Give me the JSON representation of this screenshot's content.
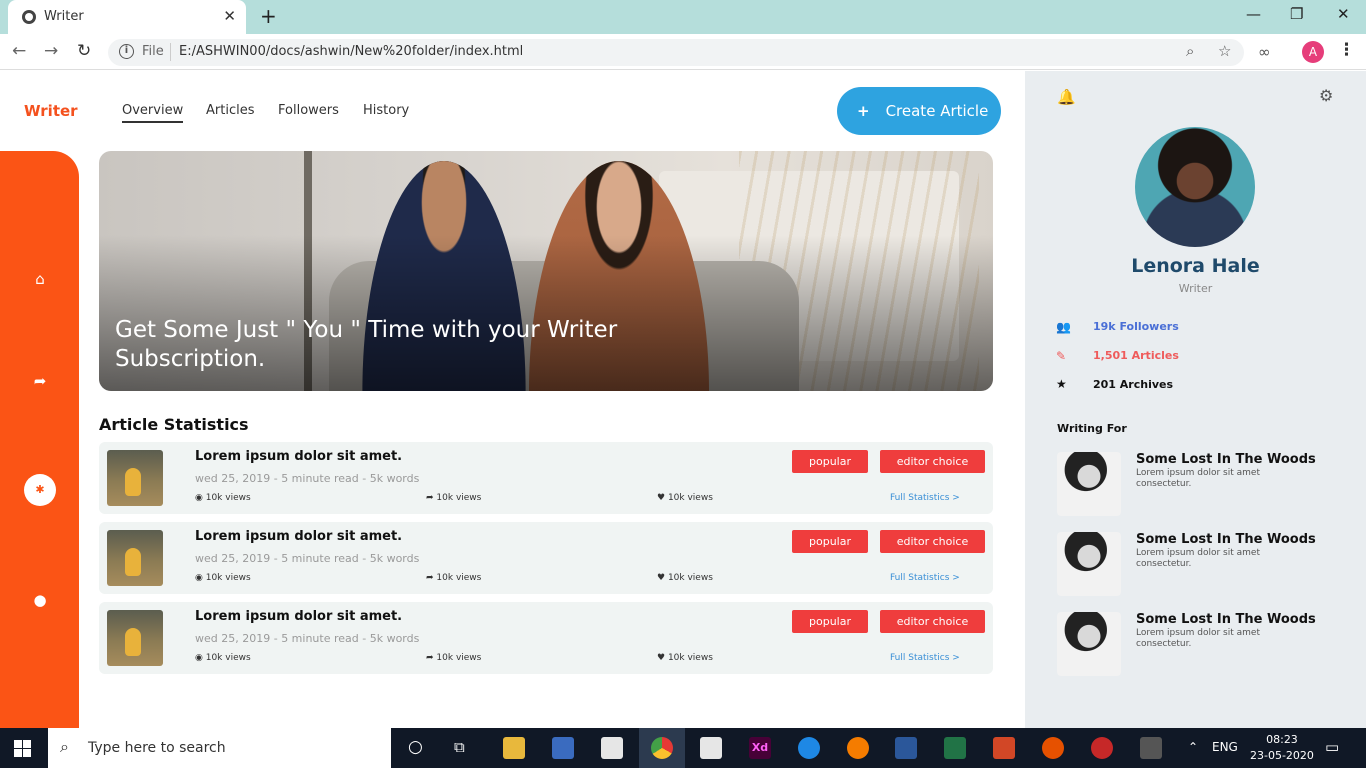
{
  "browser": {
    "tab_title": "Writer",
    "url_scheme": "File",
    "url": "E:/ASHWIN00/docs/ashwin/New%20folder/index.html",
    "profile_initial": "A"
  },
  "app": {
    "brand": "Writer",
    "nav": [
      "Overview",
      "Articles",
      "Followers",
      "History"
    ],
    "create_button": "Create Article",
    "hero_text": "Get Some Just \" You \" Time with your Writer Subscription.",
    "section_title": "Article Statistics",
    "articles": [
      {
        "title": "Lorem ipsum dolor sit amet.",
        "meta": "wed 25, 2019 - 5 minute read - 5k words",
        "views": "10k views",
        "shares": "10k views",
        "likes": "10k views",
        "badge1": "popular",
        "badge2": "editor choice",
        "link": "Full Statistics >"
      },
      {
        "title": "Lorem ipsum dolor sit amet.",
        "meta": "wed 25, 2019 - 5 minute read - 5k words",
        "views": "10k views",
        "shares": "10k views",
        "likes": "10k views",
        "badge1": "popular",
        "badge2": "editor choice",
        "link": "Full Statistics >"
      },
      {
        "title": "Lorem ipsum dolor sit amet.",
        "meta": "wed 25, 2019 - 5 minute read - 5k words",
        "views": "10k views",
        "shares": "10k views",
        "likes": "10k views",
        "badge1": "popular",
        "badge2": "editor choice",
        "link": "Full Statistics >"
      }
    ]
  },
  "profile": {
    "name": "Lenora Hale",
    "role": "Writer",
    "stats": [
      {
        "icon": "users-icon",
        "text": "19k Followers",
        "color": "#4a6fd6"
      },
      {
        "icon": "edit-icon",
        "text": "1,501 Articles",
        "color": "#ef5b5b"
      },
      {
        "icon": "star-icon",
        "text": "201 Archives",
        "color": "#111111"
      }
    ],
    "writing_for_title": "Writing For",
    "writing_for": [
      {
        "title": "Some Lost In The Woods",
        "desc": "Lorem ipsum dolor sit amet consectetur."
      },
      {
        "title": "Some Lost In The Woods",
        "desc": "Lorem ipsum dolor sit amet consectetur."
      },
      {
        "title": "Some Lost In The Woods",
        "desc": "Lorem ipsum dolor sit amet consectetur."
      }
    ]
  },
  "taskbar": {
    "search_placeholder": "Type here to search",
    "language": "ENG",
    "time": "08:23",
    "date": "23-05-2020"
  },
  "colors": {
    "accent_orange": "#fb5415",
    "button_blue": "#2ea3e0",
    "badge_red": "#ef3d3d",
    "profile_name": "#1f4a6b"
  }
}
